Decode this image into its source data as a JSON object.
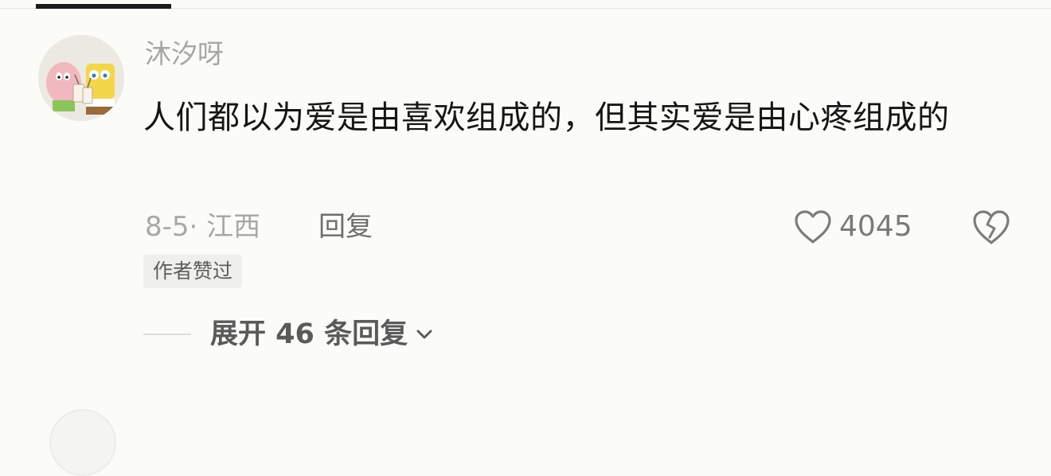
{
  "comment": {
    "username": "沐汐呀",
    "text": "人们都以为爱是由喜欢组成的，但其实爱是由心疼组成的",
    "date": "8-5",
    "location": "江西",
    "meta": "8-5· 江西",
    "reply_label": "回复",
    "like_count": "4045",
    "author_badge": "作者赞过",
    "expand_replies_label": "展开 46 条回复"
  },
  "icons": {
    "like": "heart-outline-icon",
    "dislike": "broken-heart-icon",
    "expand": "chevron-down-icon"
  },
  "colors": {
    "background": "#fbfbf8",
    "username": "#a6a6a6",
    "text": "#161616",
    "meta": "#a8a8a8"
  }
}
